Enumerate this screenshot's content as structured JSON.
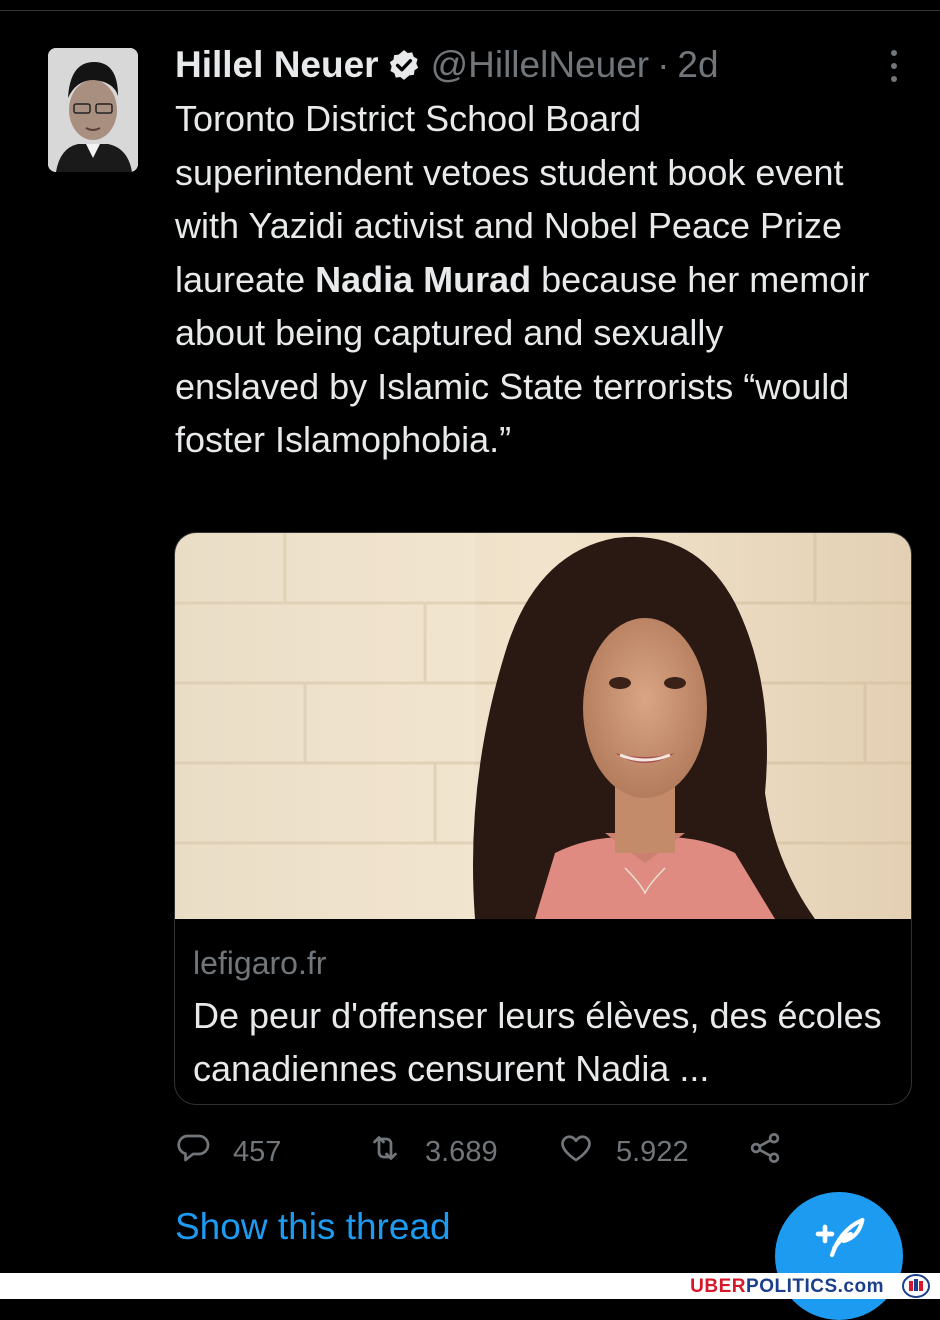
{
  "tweet": {
    "author_name": "Hillel Neuer",
    "handle": "@HillelNeuer",
    "separator": "·",
    "time": "2d",
    "text_part1": "Toronto District School Board superintendent vetoes student book event with Yazidi activist and Nobel Peace Prize laureate ",
    "text_bold": "Nadia Murad",
    "text_part2": " because her memoir about being captured and sexually enslaved by Islamic State terrorists “would foster Islamophobia.”"
  },
  "card": {
    "domain": "lefigaro.fr",
    "title": "De peur d'offenser leurs élèves, des écoles canadiennes censurent Nadia ..."
  },
  "actions": {
    "replies": "457",
    "retweets": "3.689",
    "likes": "5.922"
  },
  "thread_link": "Show this thread",
  "watermark": {
    "part1": "UBER",
    "part2": "POLITICS",
    "part3": ".com"
  },
  "icons": {
    "verified": "verified-badge-icon",
    "more": "more-options-icon",
    "reply": "reply-icon",
    "retweet": "retweet-icon",
    "like": "heart-icon",
    "share": "share-icon",
    "compose": "compose-tweet-icon"
  },
  "colors": {
    "background": "#000000",
    "text": "#e7e9ea",
    "secondary": "#71767b",
    "accent": "#1d9bf0"
  }
}
